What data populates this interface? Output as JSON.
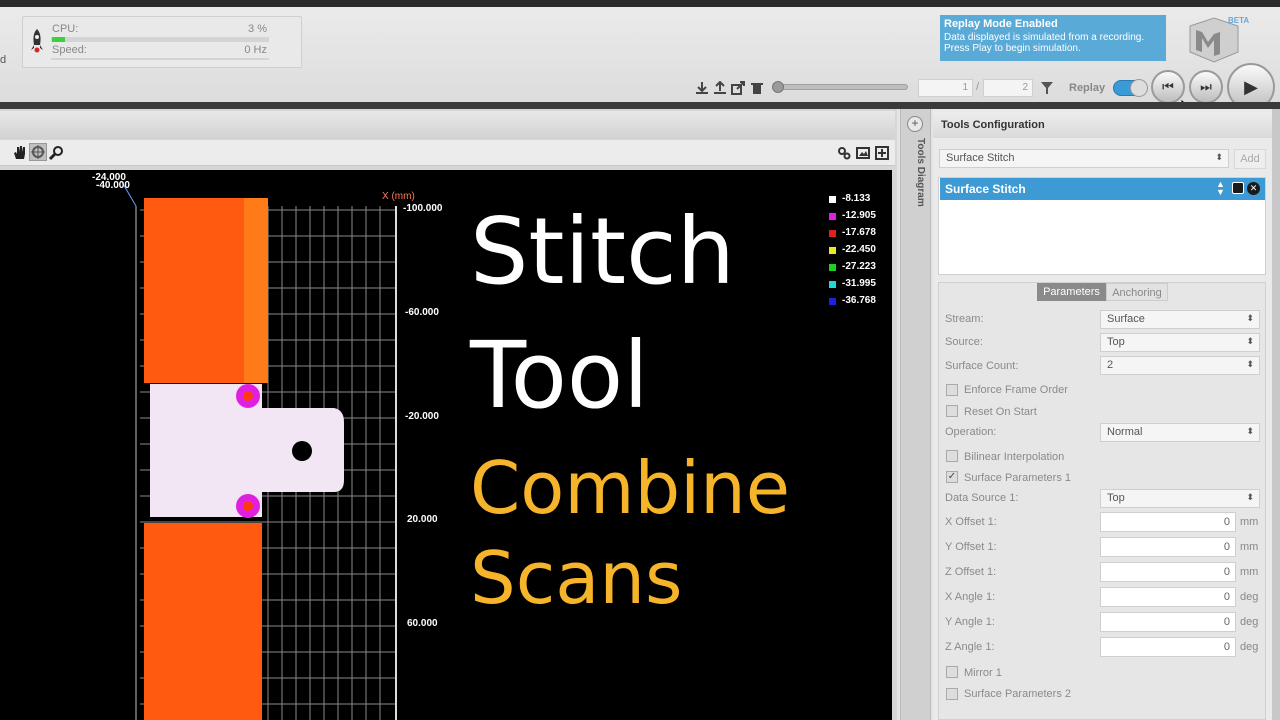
{
  "perf": {
    "cpu_label": "CPU:",
    "cpu_value": "3 %",
    "cpu_fraction": 0.03,
    "speed_label": "Speed:",
    "speed_value": "0 Hz"
  },
  "sidebar_edge": "d",
  "replay_banner": {
    "title": "Replay Mode Enabled",
    "message": "Data displayed is simulated from a recording. Press Play to begin simulation."
  },
  "logo": {
    "badge": "BETA"
  },
  "replay": {
    "frame_current": "1",
    "frame_sep": "/",
    "frame_total": "2",
    "label": "Replay"
  },
  "tools_diagram_label": "Tools Diagram",
  "panel": {
    "title": "Tools Configuration",
    "tool_dropdown": "Surface Stitch",
    "add_label": "Add",
    "selected_tool": "Surface Stitch",
    "tabs": [
      "Parameters",
      "Anchoring"
    ],
    "fields": {
      "stream": {
        "label": "Stream:",
        "value": "Surface"
      },
      "source": {
        "label": "Source:",
        "value": "Top"
      },
      "surface_count": {
        "label": "Surface Count:",
        "value": "2"
      },
      "enforce_frame_order": {
        "label": "Enforce Frame Order",
        "checked": false
      },
      "reset_on_start": {
        "label": "Reset On Start",
        "checked": false
      },
      "operation": {
        "label": "Operation:",
        "value": "Normal"
      },
      "bilinear": {
        "label": "Bilinear Interpolation",
        "checked": false
      },
      "surface_params_1": {
        "label": "Surface Parameters 1",
        "checked": true
      },
      "data_source_1": {
        "label": "Data Source 1:",
        "value": "Top"
      },
      "x_offset_1": {
        "label": "X Offset 1:",
        "value": "0",
        "unit": "mm"
      },
      "y_offset_1": {
        "label": "Y Offset 1:",
        "value": "0",
        "unit": "mm"
      },
      "z_offset_1": {
        "label": "Z Offset 1:",
        "value": "0",
        "unit": "mm"
      },
      "x_angle_1": {
        "label": "X Angle 1:",
        "value": "0",
        "unit": "deg"
      },
      "y_angle_1": {
        "label": "Y Angle 1:",
        "value": "0",
        "unit": "deg"
      },
      "z_angle_1": {
        "label": "Z Angle 1:",
        "value": "0",
        "unit": "deg"
      },
      "mirror_1": {
        "label": "Mirror 1",
        "checked": false
      },
      "surface_params_2": {
        "label": "Surface Parameters 2",
        "checked": false
      }
    }
  },
  "viewer": {
    "corner_top": "-24.000",
    "corner_bottom": "-40.000",
    "axis_label": "X (mm)",
    "ticks": [
      "-100.000",
      "-60.000",
      "-20.000",
      "20.000",
      "60.000"
    ],
    "legend": [
      {
        "value": "-8.133",
        "color": "#ffffff"
      },
      {
        "value": "-12.905",
        "color": "#e020e0"
      },
      {
        "value": "-17.678",
        "color": "#e02020"
      },
      {
        "value": "-22.450",
        "color": "#e8e820"
      },
      {
        "value": "-27.223",
        "color": "#20d020"
      },
      {
        "value": "-31.995",
        "color": "#20d8d8"
      },
      {
        "value": "-36.768",
        "color": "#2020e0"
      }
    ]
  },
  "overlay": {
    "line1": "Stitch",
    "line2": "Tool",
    "line3": "Combine",
    "line4": "Scans"
  },
  "colors": {
    "accent_blue": "#3d9ad5",
    "banner_blue": "#5aaad8",
    "overlay_yellow": "#f5b42a",
    "scan_orange": "#ff5a10"
  }
}
